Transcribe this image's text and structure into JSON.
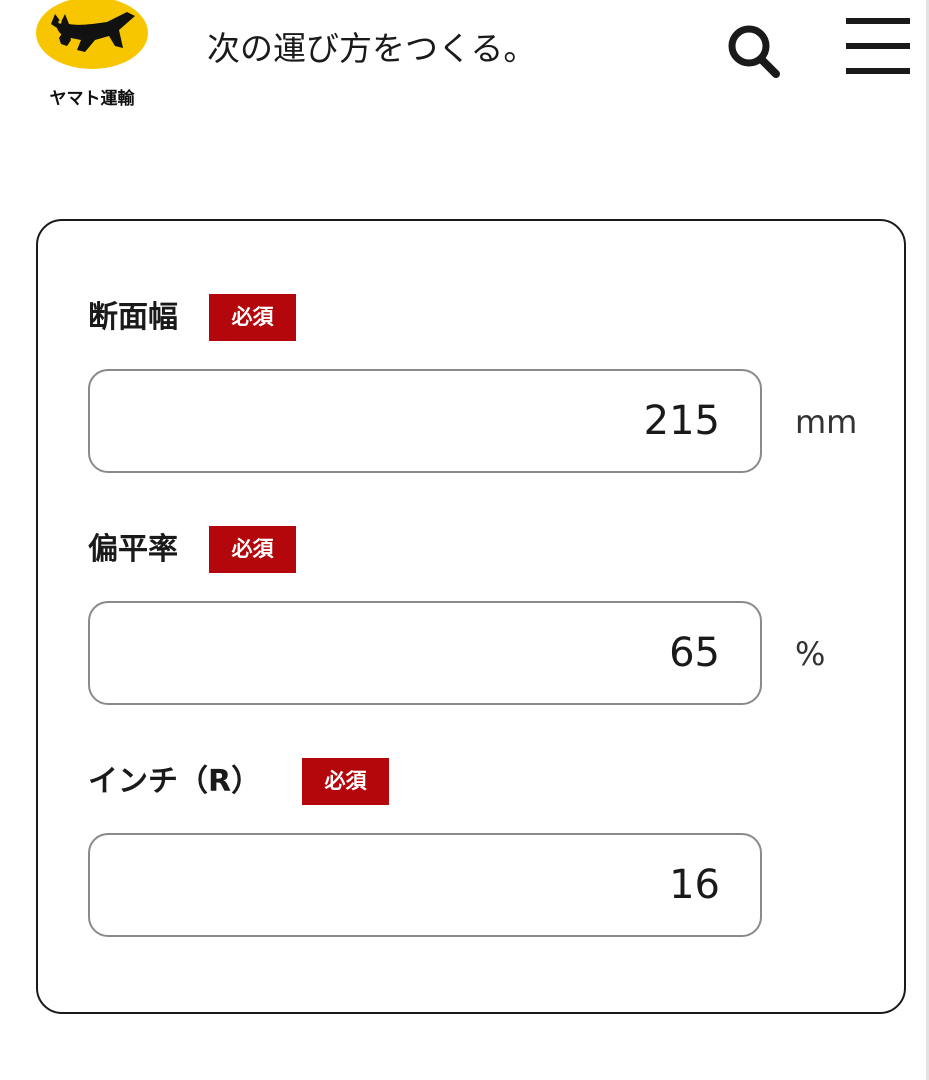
{
  "header": {
    "brand_name": "ヤマト運輸",
    "tagline": "次の運び方をつくる。",
    "icons": {
      "logo": "yamato-cat-logo",
      "search": "search-icon",
      "menu": "hamburger-menu-icon"
    },
    "brand_colors": {
      "logo_yellow": "#f7c600",
      "logo_black": "#111111"
    }
  },
  "form": {
    "required_badge_color": "#b3070b",
    "fields": [
      {
        "label": "断面幅",
        "badge": "必須",
        "value": "215",
        "unit": "mm"
      },
      {
        "label": "偏平率",
        "badge": "必須",
        "value": "65",
        "unit": "%"
      },
      {
        "label": "インチ（R）",
        "badge": "必須",
        "value": "16",
        "unit": ""
      }
    ]
  }
}
